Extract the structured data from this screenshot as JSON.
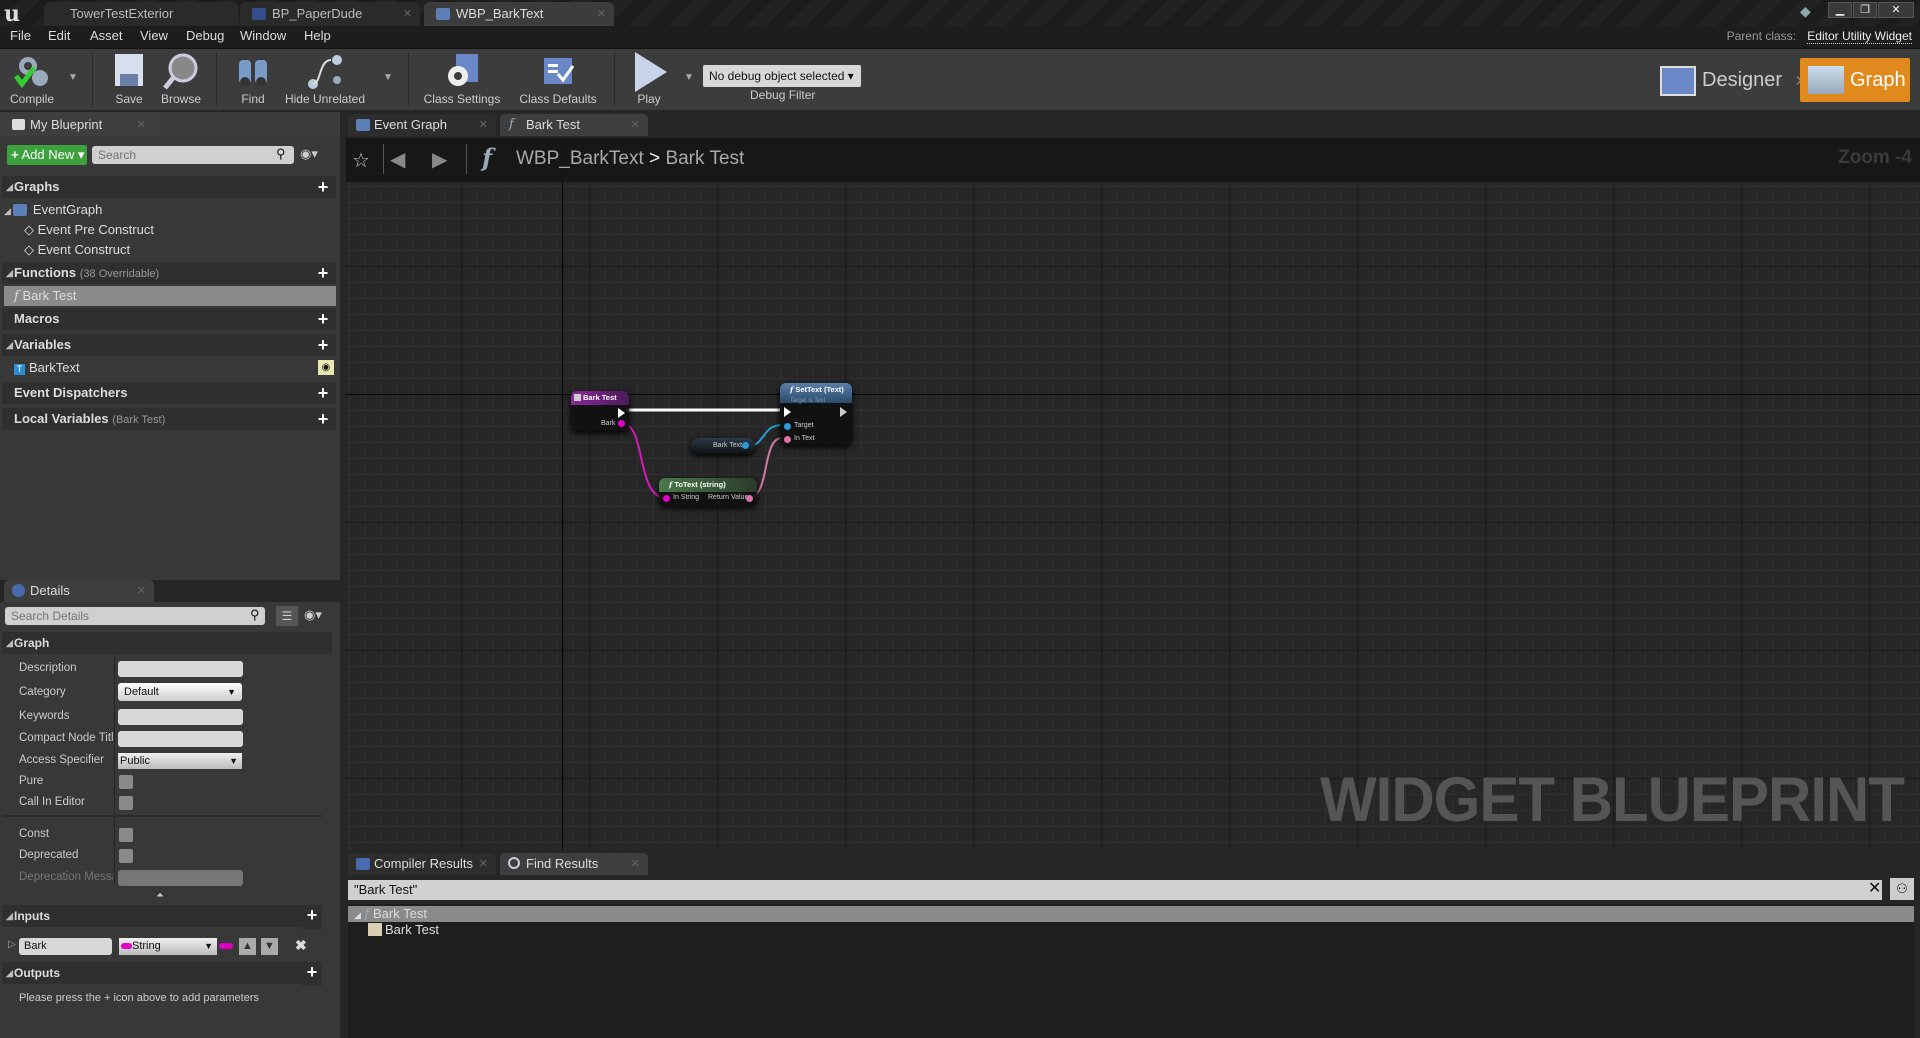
{
  "window": {
    "doc_tabs": [
      {
        "label": "TowerTestExterior",
        "active": false
      },
      {
        "label": "BP_PaperDude",
        "active": false
      },
      {
        "label": "WBP_BarkText",
        "active": true
      }
    ],
    "controls": {
      "minimize": "▁",
      "restore": "❐",
      "close": "✕"
    }
  },
  "menu": {
    "items": [
      "File",
      "Edit",
      "Asset",
      "View",
      "Debug",
      "Window",
      "Help"
    ]
  },
  "parent_class": {
    "label": "Parent class:",
    "value": "Editor Utility Widget"
  },
  "toolbar": {
    "buttons": [
      {
        "name": "compile",
        "label": "Compile",
        "icon": "compile-icon"
      },
      {
        "name": "save",
        "label": "Save",
        "icon": "save-icon"
      },
      {
        "name": "browse",
        "label": "Browse",
        "icon": "browse-icon"
      },
      {
        "name": "find",
        "label": "Find",
        "icon": "binoculars-icon"
      },
      {
        "name": "hide-unrelated",
        "label": "Hide Unrelated",
        "icon": "hide-unrelated-icon"
      },
      {
        "name": "class-settings",
        "label": "Class Settings",
        "icon": "class-settings-icon"
      },
      {
        "name": "class-defaults",
        "label": "Class Defaults",
        "icon": "class-defaults-icon"
      },
      {
        "name": "play",
        "label": "Play",
        "icon": "play-icon"
      }
    ],
    "debug_select": "No debug object selected",
    "debug_label": "Debug Filter",
    "mode_designer": "Designer",
    "mode_graph": "Graph",
    "accent": "#e08a1e"
  },
  "my_blueprint": {
    "tab": "My Blueprint",
    "add_new": "Add New",
    "search_placeholder": "Search",
    "sections": {
      "graphs": "Graphs",
      "event_graph": "EventGraph",
      "event_pre_construct": "Event Pre Construct",
      "event_construct": "Event Construct",
      "functions": "Functions",
      "functions_note": "(38 Overridable)",
      "function_item": "Bark Test",
      "macros": "Macros",
      "variables": "Variables",
      "variable_item": "BarkText",
      "event_dispatchers": "Event Dispatchers",
      "local_variables": "Local Variables",
      "local_variables_note": "(Bark Test)"
    }
  },
  "details": {
    "tab": "Details",
    "search_placeholder": "Search Details",
    "graph_section": "Graph",
    "rows": {
      "description": {
        "label": "Description",
        "value": ""
      },
      "category": {
        "label": "Category",
        "value": "Default"
      },
      "keywords": {
        "label": "Keywords",
        "value": ""
      },
      "compact": {
        "label": "Compact Node Titl",
        "value": ""
      },
      "access": {
        "label": "Access Specifier",
        "value": "Public"
      },
      "pure": {
        "label": "Pure",
        "checked": false
      },
      "call_in_editor": {
        "label": "Call In Editor",
        "checked": false
      },
      "const": {
        "label": "Const",
        "checked": false
      },
      "deprecated": {
        "label": "Deprecated",
        "checked": false
      },
      "deprecation_msg": {
        "label": "Deprecation Messa",
        "value": ""
      }
    },
    "inputs_section": "Inputs",
    "input_param": {
      "name": "Bark",
      "type": "String",
      "type_color": "#e000c8"
    },
    "outputs_section": "Outputs",
    "outputs_hint": "Please press the + icon above to add parameters"
  },
  "graph_tabs": [
    {
      "label": "Event Graph",
      "active": false
    },
    {
      "label": "Bark Test",
      "active": true
    }
  ],
  "breadcrumb": {
    "blueprint": "WBP_BarkText",
    "separator": ">",
    "function": "Bark Test"
  },
  "zoom_label": "Zoom -4",
  "watermark": "WIDGET BLUEPRINT",
  "nodes": {
    "entry": {
      "title": "Bark Test",
      "pin_bark": "Bark"
    },
    "settext": {
      "title": "SetText (Text)",
      "subtitle": "Target is Text",
      "pin_target": "Target",
      "pin_intext": "In Text"
    },
    "var": {
      "label": "Bark Text"
    },
    "totext": {
      "title": "ToText (string)",
      "pin_in": "In String",
      "pin_out": "Return Value"
    }
  },
  "bottom": {
    "tabs": [
      {
        "label": "Compiler Results",
        "active": false
      },
      {
        "label": "Find Results",
        "active": true
      }
    ],
    "query": "\"Bark Test\"",
    "results": [
      {
        "label": "Bark Test",
        "level": 0
      },
      {
        "label": "Bark Test",
        "level": 1
      }
    ]
  }
}
